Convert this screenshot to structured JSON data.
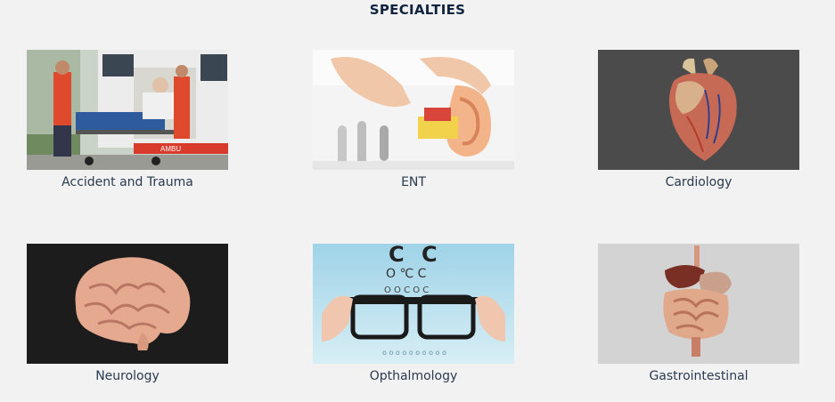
{
  "page": {
    "title": "SPECIALTIES"
  },
  "specialties": [
    {
      "label": "Accident and Trauma",
      "icon": "ambulance-stretcher-photo"
    },
    {
      "label": "ENT",
      "icon": "ear-model-photo"
    },
    {
      "label": "Cardiology",
      "icon": "heart-model-photo"
    },
    {
      "label": "Neurology",
      "icon": "brain-model-photo"
    },
    {
      "label": "Opthalmology",
      "icon": "eyeglasses-eye-chart-photo"
    },
    {
      "label": "Gastrointestinal",
      "icon": "digestive-system-photo"
    }
  ],
  "colors": {
    "background": "#f2f2f2",
    "title": "#10233f",
    "label": "#2a3a4f"
  }
}
